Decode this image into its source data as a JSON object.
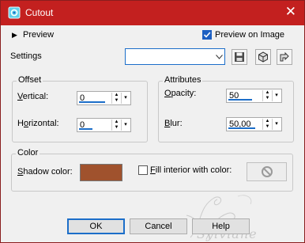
{
  "window": {
    "title": "Cutout",
    "close_glyph": "✕",
    "icon": "cutout-icon"
  },
  "header": {
    "preview_toggle_label": "Preview",
    "preview_on_image_label": "Preview on Image",
    "preview_on_image_checked": true
  },
  "settings": {
    "label": "Settings",
    "value": "",
    "icons": [
      "save-preset-icon",
      "reset-icon",
      "load-preset-icon"
    ]
  },
  "offset": {
    "legend": "Offset",
    "vertical": {
      "label_u": "V",
      "label_rest": "ertical:",
      "value": "0",
      "fill": 0.95
    },
    "horizontal": {
      "label_pre": "H",
      "label_u": "o",
      "label_rest": "rizontal:",
      "value": "0",
      "fill": 0.5
    }
  },
  "attributes": {
    "legend": "Attributes",
    "opacity": {
      "label_u": "O",
      "label_rest": "pacity:",
      "value": "50",
      "fill": 0.5
    },
    "blur": {
      "label_u": "B",
      "label_rest": "lur:",
      "value": "50,00",
      "fill": 0.95
    }
  },
  "color": {
    "legend": "Color",
    "shadow_label_u": "S",
    "shadow_label_rest": "hadow color:",
    "shadow_color": "#a0522d",
    "fill_interior_u": "F",
    "fill_interior_rest": "ill interior with color:",
    "fill_interior_checked": false
  },
  "watermark": {
    "text": "Sylviane"
  },
  "buttons": {
    "ok": "OK",
    "cancel": "Cancel",
    "help": "Help"
  },
  "colors": {
    "titlebar": "#c3201f",
    "accent": "#1c6ec9"
  }
}
